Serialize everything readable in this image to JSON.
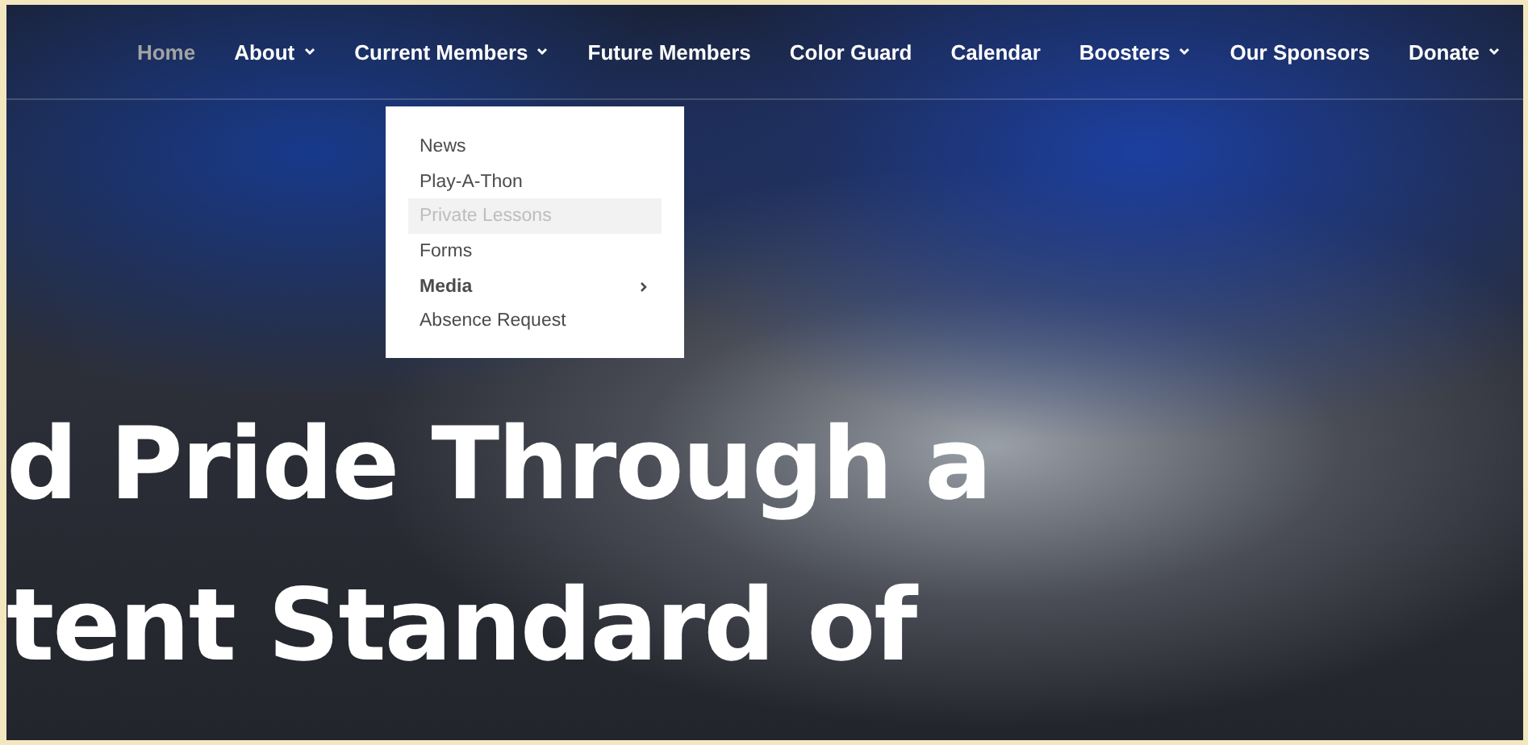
{
  "nav": {
    "items": [
      {
        "label": "Home",
        "selected": true,
        "has_dropdown": false
      },
      {
        "label": "About",
        "selected": false,
        "has_dropdown": true
      },
      {
        "label": "Current Members",
        "selected": false,
        "has_dropdown": true
      },
      {
        "label": "Future Members",
        "selected": false,
        "has_dropdown": false
      },
      {
        "label": "Color Guard",
        "selected": false,
        "has_dropdown": false
      },
      {
        "label": "Calendar",
        "selected": false,
        "has_dropdown": false
      },
      {
        "label": "Boosters",
        "selected": false,
        "has_dropdown": true
      },
      {
        "label": "Our Sponsors",
        "selected": false,
        "has_dropdown": false
      },
      {
        "label": "Donate",
        "selected": false,
        "has_dropdown": true
      }
    ]
  },
  "dropdown": {
    "items": [
      {
        "label": "News",
        "hovered": false,
        "kind": "link"
      },
      {
        "label": "Play-A-Thon",
        "hovered": false,
        "kind": "link"
      },
      {
        "label": "Private Lessons",
        "hovered": true,
        "kind": "link"
      },
      {
        "label": "Forms",
        "hovered": false,
        "kind": "link"
      },
      {
        "label": "Media",
        "hovered": false,
        "kind": "submenu"
      },
      {
        "label": "Absence Request",
        "hovered": false,
        "kind": "link"
      }
    ]
  },
  "hero": {
    "lines": [
      "d Pride Through a",
      "tent Standard of"
    ]
  }
}
